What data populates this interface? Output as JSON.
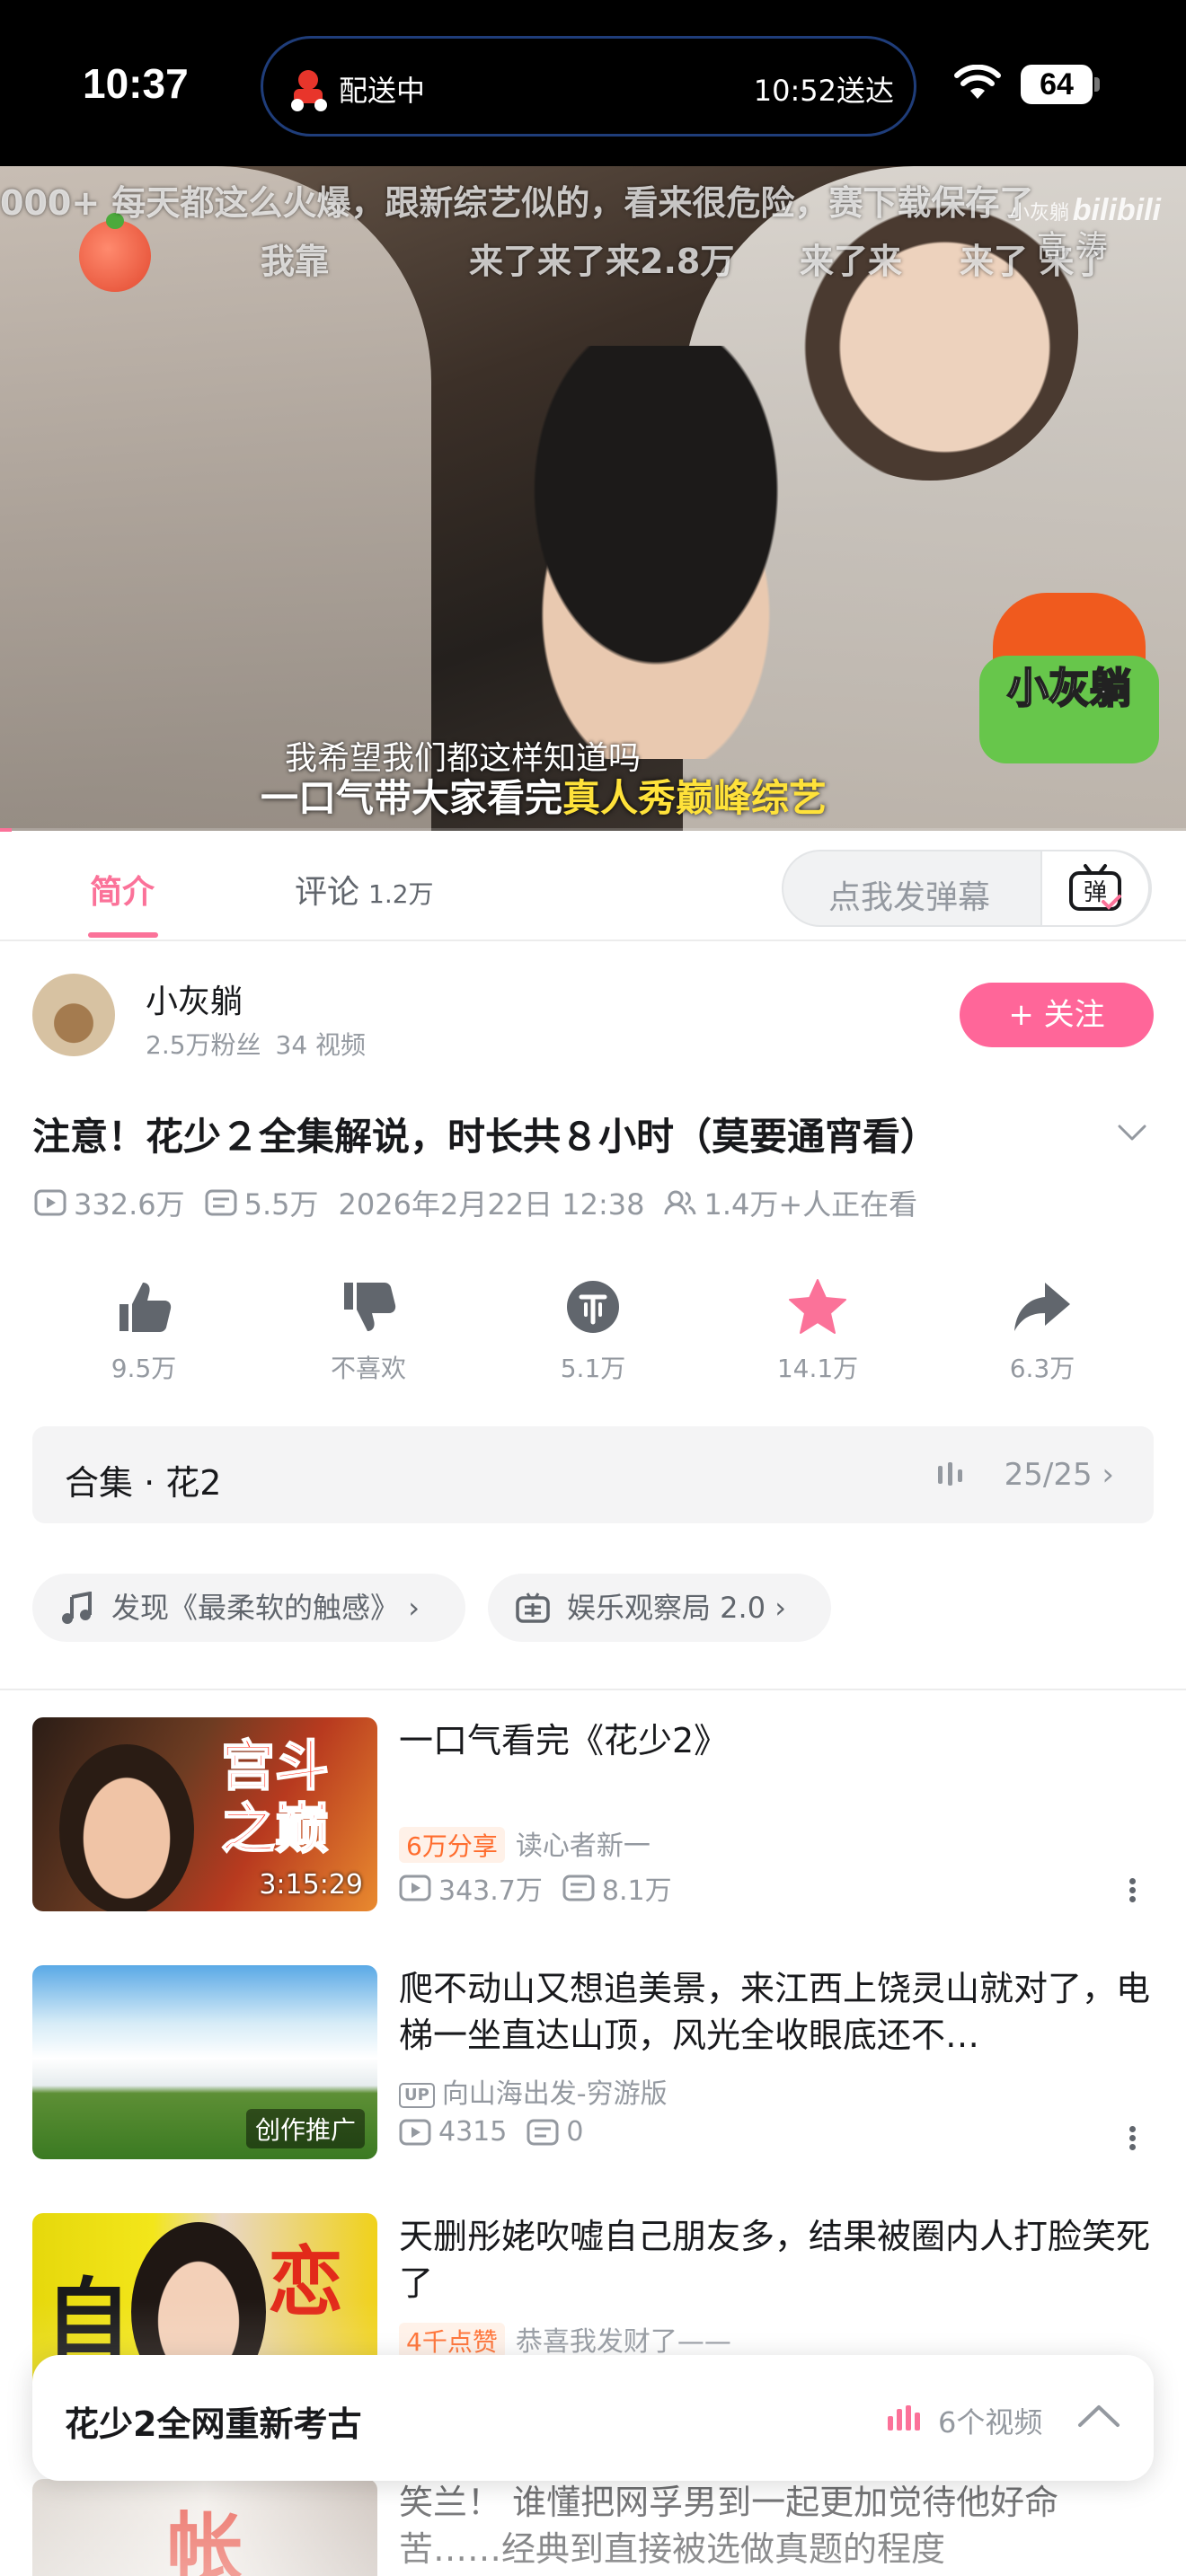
{
  "status_bar": {
    "time": "10:37",
    "island_left": "配送中",
    "island_right": "10:52送达",
    "battery": "64"
  },
  "video": {
    "danmaku": [
      "000+ 每天都这么火爆，跟新综艺似的，看来很危险，赛下载保存了",
      "我靠",
      "来了来了来2.8万",
      "来了来",
      "来了 来了"
    ],
    "uploader_watermark": "小灰躺",
    "watermark_name": "高 涛",
    "brand": "bilibili",
    "sticker_text": "小灰躺",
    "subtitle_line1": "我希望我们都这样知道吗",
    "subtitle_line2_prefix": "一口气带大家看完",
    "subtitle_line2_highlight": "真人秀巅峰综艺",
    "progress_fraction": 0.01
  },
  "tabs": {
    "intro": "简介",
    "comments": "评论",
    "comments_count": "1.2万",
    "danmaku_placeholder": "点我发弹幕",
    "danmaku_btn": "弹"
  },
  "uploader": {
    "name": "小灰躺",
    "fans": "2.5万粉丝",
    "videos": "34 视频",
    "follow_label": "+ 关注"
  },
  "video_info": {
    "title": "注意！花少２全集解说，时长共８小时（莫要通宵看）",
    "plays": "332.6万",
    "danmaku_count": "5.5万",
    "date": "2026年2月22日 12:38",
    "watching": "1.4万+人正在看"
  },
  "actions": [
    {
      "icon": "like-icon",
      "label": "9.5万"
    },
    {
      "icon": "dislike-icon",
      "label": "不喜欢"
    },
    {
      "icon": "coin-icon",
      "label": "5.1万"
    },
    {
      "icon": "favorite-star-icon",
      "label": "14.1万"
    },
    {
      "icon": "share-icon",
      "label": "6.3万"
    }
  ],
  "collection": {
    "title": "合集 · 花2",
    "progress": "25/25"
  },
  "chips": {
    "music": "发现《最柔软的触感》",
    "entertainment": "娱乐观察局 2.0"
  },
  "recommendations": [
    {
      "title": "一口气看完《花少2》",
      "thumb_text": "宫斗之巅",
      "duration": "3:15:29",
      "badge": "6万分享",
      "author": "读心者新一",
      "plays": "343.7万",
      "danmaku": "8.1万"
    },
    {
      "title": "爬不动山又想追美景，来江西上饶灵山就对了，电梯一坐直达山顶，风光全收眼底还不…",
      "thumb_tag": "创作推广",
      "up_tag": "UP",
      "author": "向山海出发-穷游版",
      "plays": "4315",
      "danmaku": "0"
    },
    {
      "title": "天删彤姥吹嘘自己朋友多，结果被圈内人打脸笑死了",
      "thumb_text_1": "自",
      "thumb_text_2": "恋",
      "badge": "4千点赞",
      "author": "恭喜我发财了——"
    },
    {
      "title": "笑兰！ 谁懂把网孚男到一起更加觉待他好命苦……经典到直接被选做真题的程度",
      "thumb_text": "帐"
    }
  ],
  "playlist_bar": {
    "title": "花少2全网重新考古",
    "count": "6个视频"
  },
  "colors": {
    "accent_pink": "#fb7299",
    "follow_pink": "#ff6699",
    "badge_orange": "#ff6d2e",
    "text_grey": "#9499a0"
  }
}
